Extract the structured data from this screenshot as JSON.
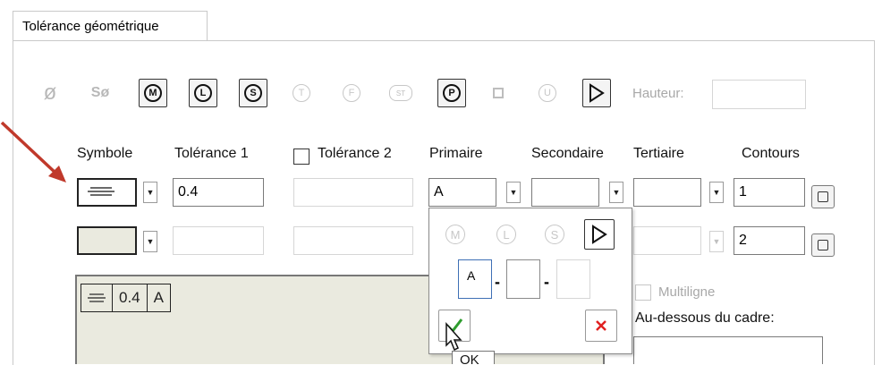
{
  "tab": {
    "label": "Tolérance géométrique"
  },
  "toolbar": {
    "diameter": "ø",
    "spherical_diameter": "Sø",
    "mmc": "M",
    "lmc": "L",
    "rfs": "S",
    "tangent_plane": "T",
    "free_state": "F",
    "statistical": "ST",
    "projected_zone": "P",
    "unequal": "U",
    "height_label": "Hauteur:",
    "height_value": ""
  },
  "headers": {
    "symbol": "Symbole",
    "tol1": "Tolérance 1",
    "tol2": "Tolérance 2",
    "primary": "Primaire",
    "secondary": "Secondaire",
    "tertiary": "Tertiaire",
    "contours": "Contours"
  },
  "row1": {
    "tol1": "0.4",
    "tol2": "",
    "primary": "A",
    "secondary": "",
    "tertiary": "",
    "contour": "1"
  },
  "row2": {
    "tol1": "",
    "tol2": "",
    "tertiary": "",
    "contour": "2"
  },
  "popup": {
    "mmc": "M",
    "lmc": "L",
    "rfs": "S",
    "datum1": "A",
    "datum2": "",
    "datum3": "",
    "dash": "-",
    "tooltip": "OK"
  },
  "frame": {
    "tol": "0.4",
    "datum": "A"
  },
  "options": {
    "multiline_label": "Multiligne",
    "below_frame_label": "Au-dessous du cadre:"
  },
  "colors": {
    "arrow": "#c0392b",
    "accept": "#2e9d2e",
    "cancel": "#e02020"
  }
}
